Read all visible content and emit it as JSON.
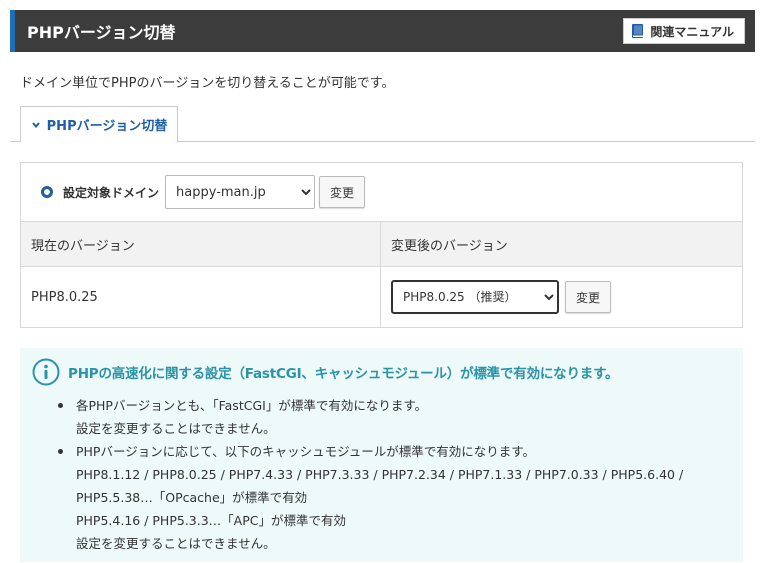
{
  "header": {
    "title": "PHPバージョン切替",
    "manual_label": "関連マニュアル"
  },
  "intro": "ドメイン単位でPHPのバージョンを切り替えることが可能です。",
  "tab": {
    "label": "PHPバージョン切替"
  },
  "domain": {
    "label": "設定対象ドメイン",
    "selected": "happy-man.jp",
    "change_label": "変更"
  },
  "versions": {
    "current_header": "現在のバージョン",
    "new_header": "変更後のバージョン",
    "current_value": "PHP8.0.25",
    "new_selected": "PHP8.0.25 （推奨）",
    "change_label": "変更"
  },
  "info": {
    "title": "PHPの高速化に関する設定（FastCGI、キャッシュモジュール）が標準で有効になります。",
    "item1_line1": "各PHPバージョンとも、「FastCGI」が標準で有効になります。",
    "item1_line2": "設定を変更することはできません。",
    "item2_line1": "PHPバージョンに応じて、以下のキャッシュモジュールが標準で有効になります。",
    "item2_line2": "PHP8.1.12 / PHP8.0.25 / PHP7.4.33 / PHP7.3.33 / PHP7.2.34 / PHP7.1.33 / PHP7.0.33 / PHP5.6.40 /",
    "item2_line3": "PHP5.5.38…「OPcache」が標準で有効",
    "item2_line4": "PHP5.4.16 / PHP5.3.3…「APC」が標準で有効",
    "item2_line5": "設定を変更することはできません。"
  },
  "icons": {
    "manual": "book-icon",
    "tab": "chevron-down-icon",
    "domain": "radio-icon",
    "info": "info-icon"
  },
  "colors": {
    "header_bg": "#3c3c3c",
    "accent": "#1f6fb8",
    "info_bg": "#eef9fa",
    "info_title": "#2a93a8"
  }
}
